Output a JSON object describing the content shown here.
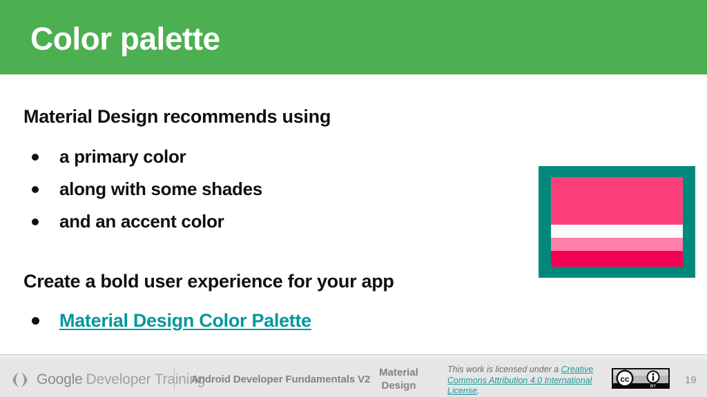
{
  "slide": {
    "title": "Color palette",
    "header_color": "#4CAF50",
    "page_number": "19"
  },
  "content": {
    "lead_1": "Material Design recommends using",
    "bullets": [
      "a primary color",
      "along with some shades",
      "and an accent color"
    ],
    "lead_2": "Create a bold user experience for your app",
    "link_bullet": {
      "label": "Material Design Color Palette",
      "color": "#00979D"
    }
  },
  "swatch": {
    "border_color": "#00897B",
    "bands": [
      {
        "name": "primary-pink",
        "color": "#FB4079",
        "height_pct": 53
      },
      {
        "name": "white",
        "color": "#FAFAFA",
        "height_pct": 15
      },
      {
        "name": "light-pink",
        "color": "#FF80AB",
        "height_pct": 14
      },
      {
        "name": "accent-pink",
        "color": "#F50057",
        "height_pct": 18
      }
    ]
  },
  "footer": {
    "logo_google": "Google",
    "logo_devtraining": "Developer Training",
    "logo_mark_icon": "code-brackets-icon",
    "course_name": "Android Developer Fundamentals V2",
    "topic_name": "Material\nDesign",
    "topic_line_1": "Material",
    "topic_line_2": "Design",
    "license_prefix": "This work is licensed under a ",
    "license_link": "Creative Commons Attribution 4.0 International License",
    "license_suffix": ".",
    "cc_badge_icon": "creative-commons-by-badge-icon",
    "background_color": "#E6E6E6"
  }
}
